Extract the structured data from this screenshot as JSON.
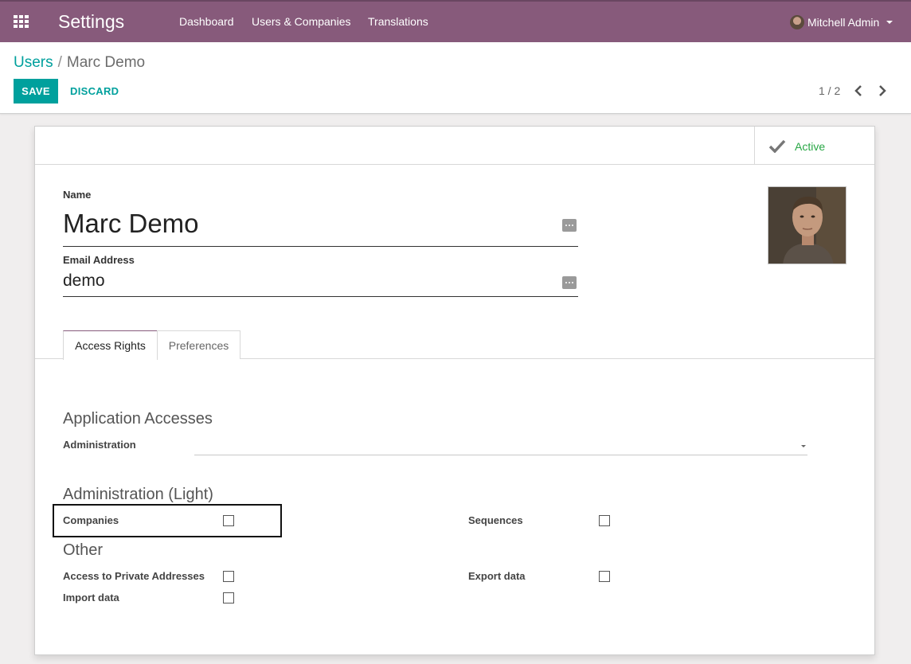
{
  "navbar": {
    "brand": "Settings",
    "items": [
      "Dashboard",
      "Users & Companies",
      "Translations"
    ],
    "user": "Mitchell Admin"
  },
  "breadcrumb": {
    "parent": "Users",
    "separator": "/",
    "current": "Marc Demo"
  },
  "toolbar": {
    "save_label": "SAVE",
    "discard_label": "DISCARD"
  },
  "pager": {
    "text": "1 / 2"
  },
  "status": {
    "active_label": "Active"
  },
  "form": {
    "name_label": "Name",
    "name_value": "Marc Demo",
    "email_label": "Email Address",
    "email_value": "demo"
  },
  "tabs": [
    "Access Rights",
    "Preferences"
  ],
  "sections": {
    "application_accesses": {
      "title": "Application Accesses",
      "administration_label": "Administration",
      "administration_value": ""
    },
    "administration_light": {
      "title": "Administration (Light)",
      "companies_label": "Companies",
      "companies_checked": false,
      "sequences_label": "Sequences",
      "sequences_checked": false
    },
    "other": {
      "title": "Other",
      "private_addresses_label": "Access to Private Addresses",
      "private_addresses_checked": false,
      "export_data_label": "Export data",
      "export_data_checked": false,
      "import_data_label": "Import data",
      "import_data_checked": false
    }
  },
  "colors": {
    "navbar": "#875a7b",
    "accent": "#00a09d",
    "active_green": "#28a745"
  }
}
